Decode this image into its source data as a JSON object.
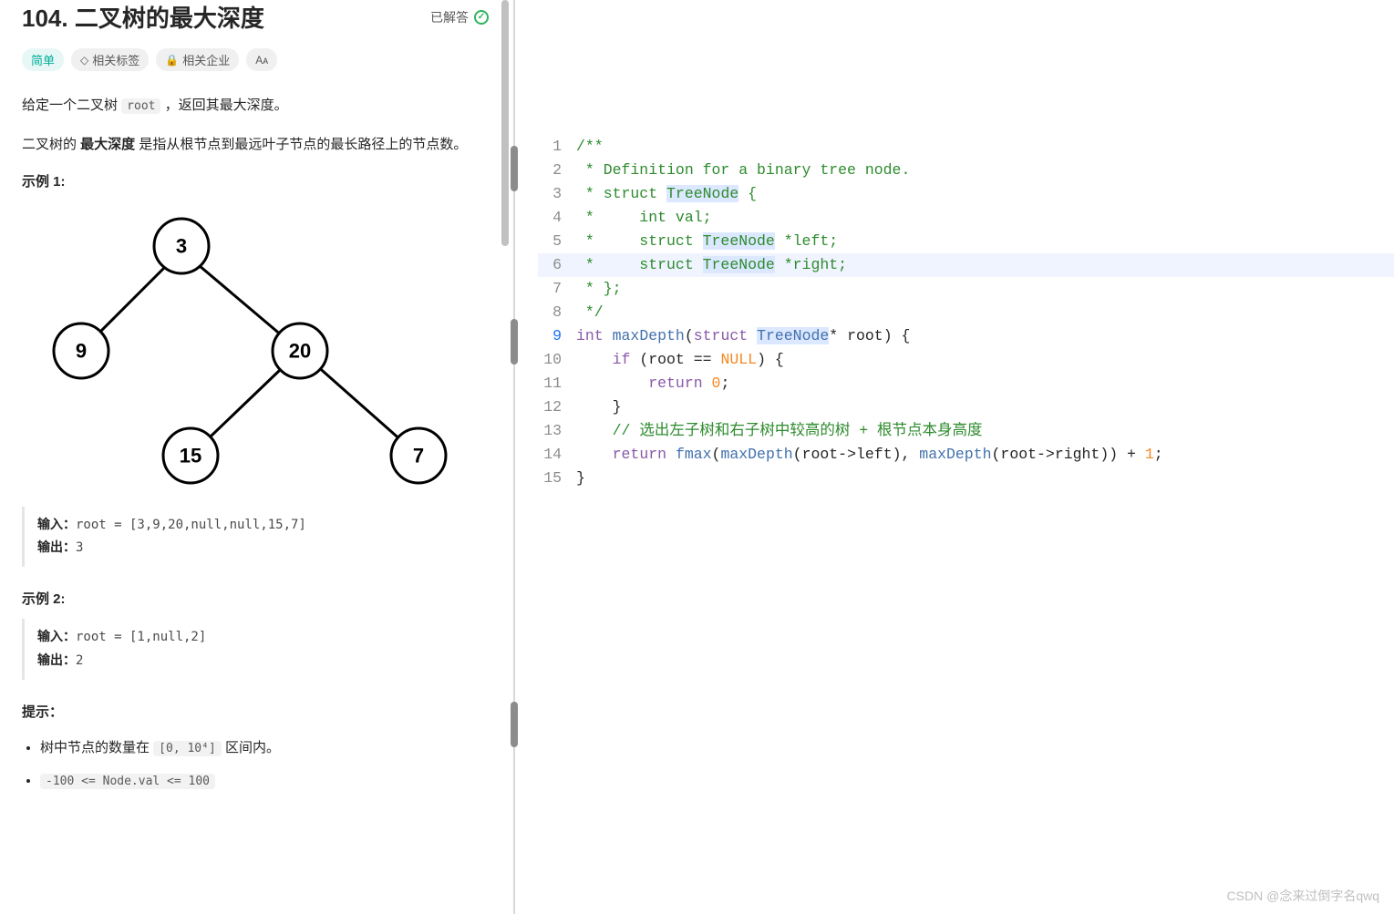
{
  "header": {
    "title": "104. 二叉树的最大深度",
    "solved_label": "已解答"
  },
  "tags": {
    "difficulty": "简单",
    "related_tags": "相关标签",
    "companies": "相关企业"
  },
  "description": {
    "line1_pre": "给定一个二叉树 ",
    "line1_code": "root",
    "line1_post": " ，返回其最大深度。",
    "line2_pre": "二叉树的 ",
    "line2_bold": "最大深度",
    "line2_post": " 是指从根节点到最远叶子节点的最长路径上的节点数。"
  },
  "example1": {
    "label": "示例 1:",
    "tree_nodes": {
      "n1": "3",
      "n2": "9",
      "n3": "20",
      "n4": "15",
      "n5": "7"
    },
    "input_label": "输入：",
    "input_value": "root = [3,9,20,null,null,15,7]",
    "output_label": "输出：",
    "output_value": "3"
  },
  "example2": {
    "label": "示例 2:",
    "input_label": "输入：",
    "input_value": "root = [1,null,2]",
    "output_label": "输出：",
    "output_value": "2"
  },
  "hints": {
    "label": "提示：",
    "item1_pre": "树中节点的数量在 ",
    "item1_code": "[0, 10⁴]",
    "item1_post": " 区间内。",
    "item2_code": "-100 <= Node.val <= 100"
  },
  "code": {
    "lines": [
      {
        "n": 1,
        "tokens": [
          {
            "t": "/**",
            "c": "comment"
          }
        ]
      },
      {
        "n": 2,
        "tokens": [
          {
            "t": " * Definition for a binary tree node.",
            "c": "comment"
          }
        ]
      },
      {
        "n": 3,
        "tokens": [
          {
            "t": " * struct ",
            "c": "comment"
          },
          {
            "t": "TreeNode",
            "c": "comment",
            "hl": true
          },
          {
            "t": " {",
            "c": "comment"
          }
        ]
      },
      {
        "n": 4,
        "tokens": [
          {
            "t": " *     int val;",
            "c": "comment"
          }
        ]
      },
      {
        "n": 5,
        "tokens": [
          {
            "t": " *     struct ",
            "c": "comment"
          },
          {
            "t": "TreeNode",
            "c": "comment",
            "hl": true
          },
          {
            "t": " *left;",
            "c": "comment"
          }
        ]
      },
      {
        "n": 6,
        "highlight": true,
        "tokens": [
          {
            "t": " *     struct ",
            "c": "comment"
          },
          {
            "t": "TreeNode",
            "c": "comment",
            "hl": true
          },
          {
            "t": " *right;",
            "c": "comment"
          }
        ]
      },
      {
        "n": 7,
        "tokens": [
          {
            "t": " * };",
            "c": "comment"
          }
        ]
      },
      {
        "n": 8,
        "tokens": [
          {
            "t": " */",
            "c": "comment"
          }
        ]
      },
      {
        "n": 9,
        "current": true,
        "tokens": [
          {
            "t": "int",
            "c": "keyword"
          },
          {
            "t": " ",
            "c": "plain"
          },
          {
            "t": "maxDepth",
            "c": "func"
          },
          {
            "t": "(",
            "c": "plain"
          },
          {
            "t": "struct",
            "c": "keyword"
          },
          {
            "t": " ",
            "c": "plain"
          },
          {
            "t": "TreeNode",
            "c": "type",
            "hl": true
          },
          {
            "t": "* root) {",
            "c": "plain"
          }
        ]
      },
      {
        "n": 10,
        "tokens": [
          {
            "t": "    ",
            "c": "plain"
          },
          {
            "t": "if",
            "c": "keyword"
          },
          {
            "t": " (root == ",
            "c": "plain"
          },
          {
            "t": "NULL",
            "c": "num"
          },
          {
            "t": ") {",
            "c": "plain"
          }
        ]
      },
      {
        "n": 11,
        "tokens": [
          {
            "t": "        ",
            "c": "plain"
          },
          {
            "t": "return",
            "c": "keyword"
          },
          {
            "t": " ",
            "c": "plain"
          },
          {
            "t": "0",
            "c": "num"
          },
          {
            "t": ";",
            "c": "plain"
          }
        ]
      },
      {
        "n": 12,
        "tokens": [
          {
            "t": "    }",
            "c": "plain"
          }
        ]
      },
      {
        "n": 13,
        "tokens": [
          {
            "t": "    ",
            "c": "plain"
          },
          {
            "t": "// 选出左子树和右子树中较高的树 + 根节点本身高度",
            "c": "comment"
          }
        ]
      },
      {
        "n": 14,
        "tokens": [
          {
            "t": "    ",
            "c": "plain"
          },
          {
            "t": "return",
            "c": "keyword"
          },
          {
            "t": " ",
            "c": "plain"
          },
          {
            "t": "fmax",
            "c": "func"
          },
          {
            "t": "(",
            "c": "plain"
          },
          {
            "t": "maxDepth",
            "c": "func"
          },
          {
            "t": "(root->left), ",
            "c": "plain"
          },
          {
            "t": "maxDepth",
            "c": "func"
          },
          {
            "t": "(root->right)) + ",
            "c": "plain"
          },
          {
            "t": "1",
            "c": "num"
          },
          {
            "t": ";",
            "c": "plain"
          }
        ]
      },
      {
        "n": 15,
        "tokens": [
          {
            "t": "}",
            "c": "plain"
          }
        ]
      }
    ]
  },
  "watermark": "CSDN @念来过倒字名qwq"
}
